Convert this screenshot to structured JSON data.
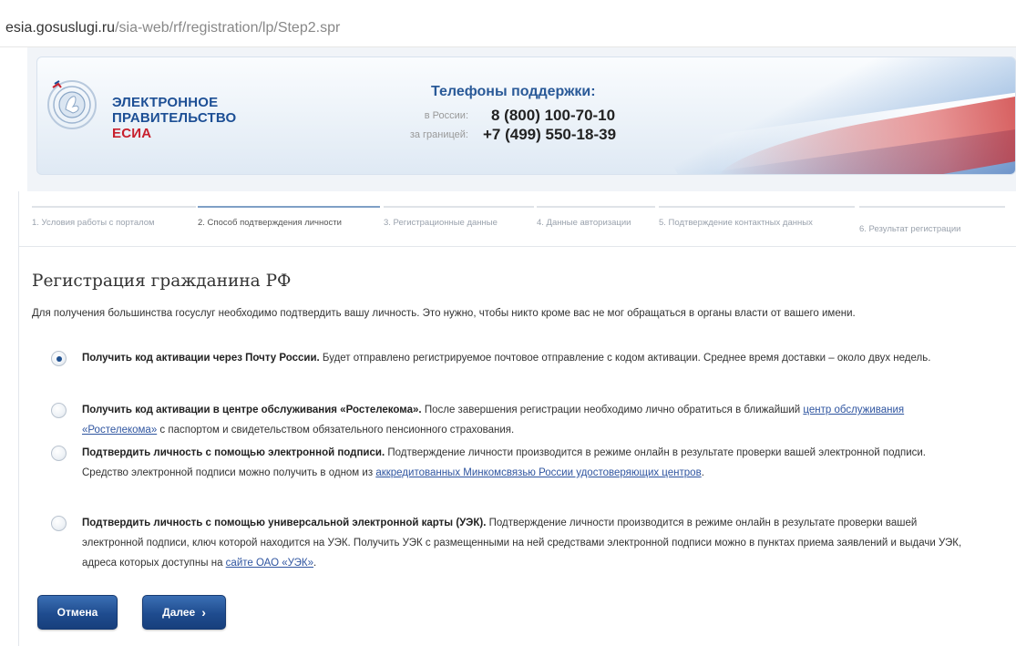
{
  "browser": {
    "url_host": "esia.gosuslugi.ru",
    "url_path": "/sia-web/rf/registration/lp/Step2.spr"
  },
  "header": {
    "logo": {
      "line1": "ЭЛЕКТРОННОЕ",
      "line2": "ПРАВИТЕЛЬСТВО",
      "line3": "ЕСИА"
    },
    "support": {
      "title": "Телефоны поддержки:",
      "russia_label": "в России:",
      "russia_number": "8 (800) 100-70-10",
      "abroad_label": "за границей:",
      "abroad_number": "+7 (499) 550-18-39"
    }
  },
  "steps": [
    {
      "label": "1. Условия работы с порталом",
      "active": false
    },
    {
      "label": "2. Способ подтверждения личности",
      "active": true
    },
    {
      "label": "3. Регистрационные данные",
      "active": false
    },
    {
      "label": "4. Данные авторизации",
      "active": false
    },
    {
      "label": "5. Подтверждение контактных данных",
      "active": false
    },
    {
      "label": "6. Результат регистрации",
      "active": false
    }
  ],
  "main": {
    "title": "Регистрация гражданина РФ",
    "intro": "Для получения большинства госуслуг необходимо подтвердить вашу личность. Это нужно, чтобы никто кроме вас не мог обращаться в органы власти от вашего имени.",
    "options": [
      {
        "bold": "Получить код активации через Почту России.",
        "text": " Будет отправлено регистрируемое почтовое отправление с кодом активации. Среднее время доставки – около двух недель.",
        "checked": true
      },
      {
        "bold": "Получить код активации в центре обслуживания «Ростелекома».",
        "text": " После завершения регистрации необходимо лично обратиться в ближайший ",
        "link": "центр обслуживания «Ростелекома»",
        "text_after": " с паспортом и свидетельством обязательного пенсионного страхования.",
        "checked": false
      },
      {
        "bold": "Подтвердить личность с помощью электронной подписи.",
        "text": " Подтверждение личности производится в режиме онлайн в результате проверки вашей электронной подписи. Средство электронной подписи можно получить в одном из ",
        "link": "аккредитованных Минкомсвязью России удостоверяющих центров",
        "text_after": ".",
        "checked": false
      },
      {
        "bold": "Подтвердить личность с помощью универсальной электронной карты (УЭК).",
        "text": " Подтверждение личности производится в режиме онлайн в результате проверки вашей электронной подписи, ключ которой находится на УЭК. Получить УЭК с размещенными на ней средствами электронной подписи можно в пунктах приема заявлений и выдачи УЭК, адреса которых доступны на ",
        "link": "сайте ОАО «УЭК»",
        "text_after": ".",
        "checked": false
      }
    ],
    "cancel_label": "Отмена",
    "next_label": "Далее",
    "next_icon": "chevron-right-icon"
  }
}
